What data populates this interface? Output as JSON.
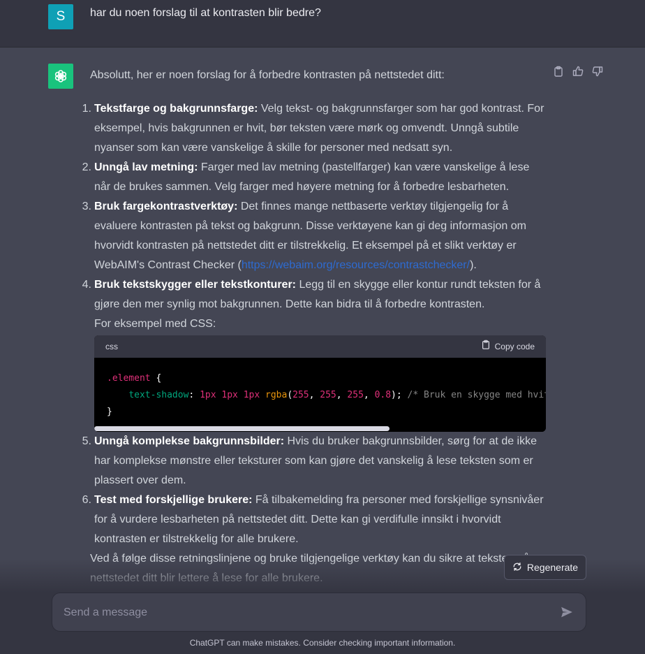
{
  "user_message": {
    "avatar_letter": "S",
    "text": "har du noen forslag til at kontrasten blir bedre?"
  },
  "assistant_message": {
    "intro": "Absolutt, her er noen forslag for å forbedre kontrasten på nettstedet ditt:",
    "items": [
      {
        "num": "1.",
        "title": "Tekstfarge og bakgrunnsfarge:",
        "text": " Velg tekst- og bakgrunnsfarger som har god kontrast. For eksempel, hvis bakgrunnen er hvit, bør teksten være mørk og omvendt. Unngå subtile nyanser som kan være vanskelige å skille for personer med nedsatt syn."
      },
      {
        "num": "2.",
        "title": "Unngå lav metning:",
        "text": " Farger med lav metning (pastellfarger) kan være vanskelige å lese når de brukes sammen. Velg farger med høyere metning for å forbedre lesbarheten."
      },
      {
        "num": "3.",
        "title": "Bruk fargekontrastverktøy:",
        "text": " Det finnes mange nettbaserte verktøy tilgjengelig for å evaluere kontrasten på tekst og bakgrunn. Disse verktøyene kan gi deg informasjon om hvorvidt kontrasten på nettstedet ditt er tilstrekkelig. Et eksempel på et slikt verktøy er WebAIM's Contrast Checker (",
        "link": "https://webaim.org/resources/contrastchecker/",
        "after": ")."
      },
      {
        "num": "4.",
        "title": "Bruk tekstskygger eller tekstkonturer:",
        "text": " Legg til en skygge eller kontur rundt teksten for å gjøre den mer synlig mot bakgrunnen. Dette kan bidra til å forbedre kontrasten.",
        "extra": "For eksempel med CSS:"
      },
      {
        "num": "5.",
        "title": "Unngå komplekse bakgrunnsbilder:",
        "text": " Hvis du bruker bakgrunnsbilder, sørg for at de ikke har komplekse mønstre eller teksturer som kan gjøre det vanskelig å lese teksten som er plassert over dem."
      },
      {
        "num": "6.",
        "title": "Test med forskjellige brukere:",
        "text": " Få tilbakemelding fra personer med forskjellige synsnivåer for å vurdere lesbarheten på nettstedet ditt. Dette kan gi verdifulle innsikt i hvorvidt kontrasten er tilstrekkelig for alle brukere."
      }
    ],
    "code": {
      "language": "css",
      "copy_label": "Copy code",
      "selector": ".element",
      "open_brace": " {",
      "property": "text-shadow",
      "colon": ": ",
      "v1": "1px",
      "v2": "1px",
      "v3": "1px",
      "fn": "rgba",
      "a1": "255",
      "a2": "255",
      "a3": "255",
      "a4": "0.8",
      "comment": "/* Bruk en skygge med hvit farge og litt gjennomsiktighet */",
      "close_brace": "}"
    },
    "trailing": "Ved å følge disse retningslinjene og bruke tilgjengelige verktøy kan du sikre at teksten på nettstedet ditt blir lettere å lese for alle brukere."
  },
  "regenerate_label": "Regenerate",
  "composer": {
    "placeholder": "Send a message"
  },
  "disclaimer": "ChatGPT can make mistakes. Consider checking important information.",
  "colors": {
    "user_avatar": "#0fa0b5",
    "gpt_avatar": "#19c37d",
    "link": "#2e6bd1"
  }
}
